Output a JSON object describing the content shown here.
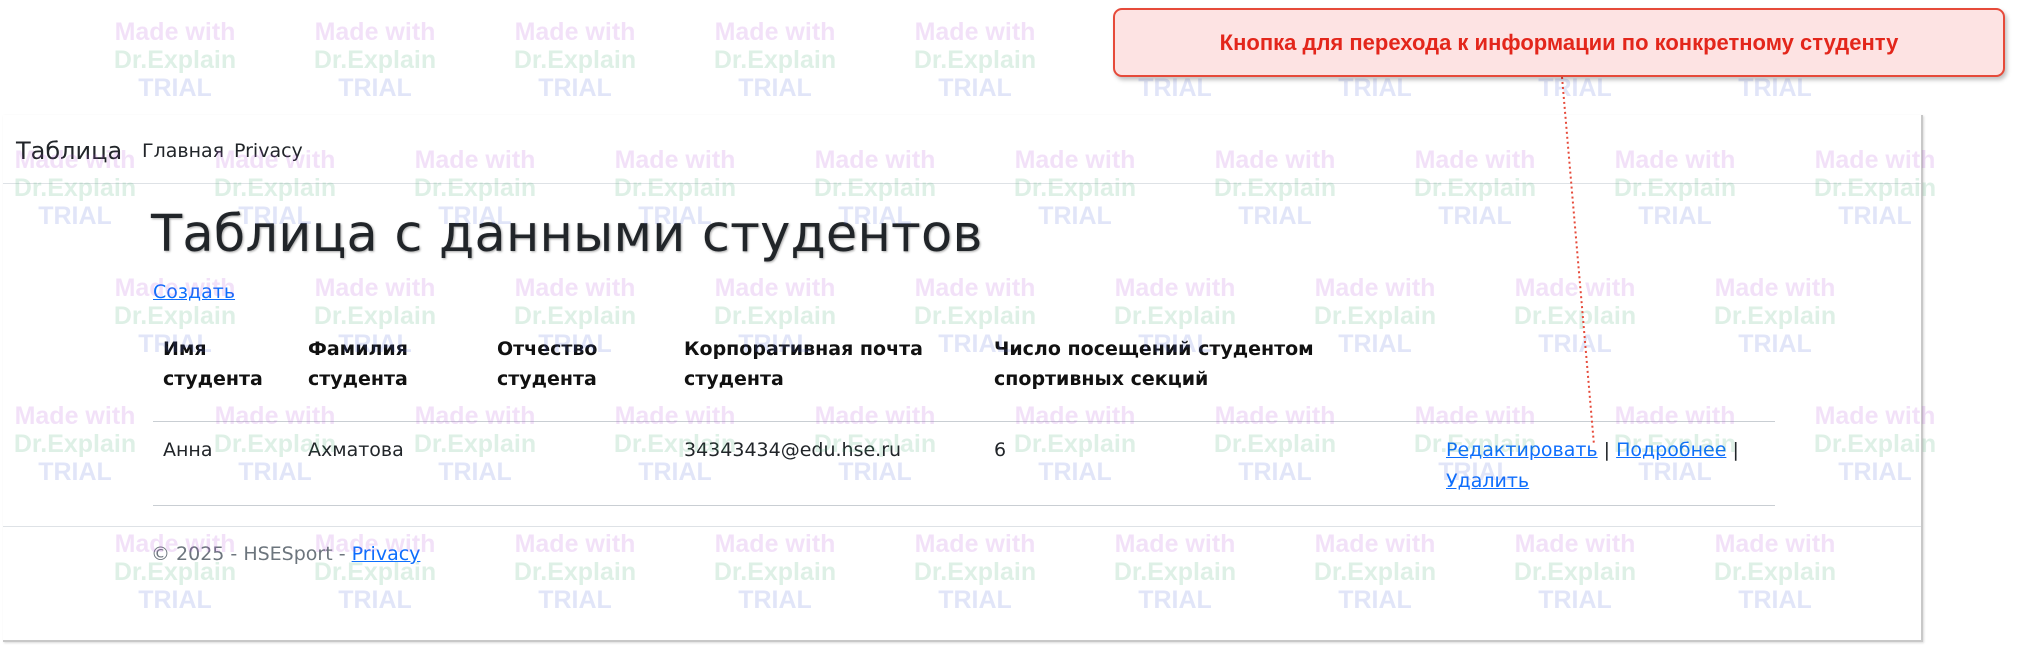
{
  "navbar": {
    "brand": "Таблица",
    "links": [
      "Главная",
      "Privacy"
    ]
  },
  "main": {
    "title": "Таблица с данными студентов",
    "create_link": "Создать",
    "table": {
      "headers": [
        "Имя студента",
        "Фамилия студента",
        "Отчество студента",
        "Корпоративная почта студента",
        "Число посещений студентом спортивных секций"
      ],
      "rows": [
        {
          "first_name": "Анна",
          "last_name": "Ахматова",
          "middle_name": "",
          "email": "34343434@edu.hse.ru",
          "visits": "6",
          "actions": {
            "edit": "Редактировать",
            "details": "Подробнее",
            "delete": "Удалить",
            "separator": "|"
          }
        }
      ]
    }
  },
  "footer": {
    "text": "© 2025 - HSESport - ",
    "privacy_link": "Privacy"
  },
  "callout": {
    "text": "Кнопка для перехода к информации по конкретному студенту",
    "border_color": "#e64a3a",
    "fill_color": "#fde3e3",
    "text_color": "#e3261b"
  },
  "watermark": {
    "line1": "Made with",
    "line2": "Dr.Explain",
    "line3": "TRIAL"
  },
  "colors": {
    "link": "#0d6efd",
    "text": "#212529"
  }
}
